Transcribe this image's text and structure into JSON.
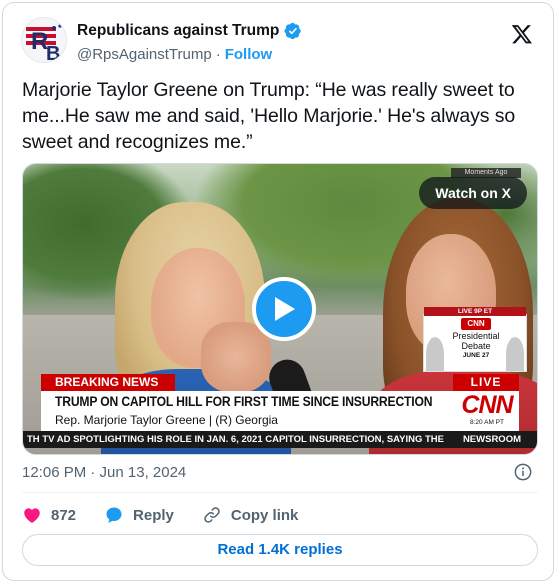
{
  "author": {
    "name": "Republicans against Trump",
    "handle": "@RpsAgainstTrump",
    "separator": "·",
    "follow_label": "Follow",
    "avatar_letters": "RB"
  },
  "tweet": {
    "text": "Marjorie Taylor Greene on Trump: “He was really sweet to me...He saw me and said, 'Hello Marjorie.' He's always so sweet and recognizes me.”"
  },
  "video": {
    "watch_label": "Watch on X",
    "top_tag": "Moments Ago",
    "promo": {
      "top": "LIVE 9P ET",
      "logo": "CNN",
      "title": "Presidential Debate",
      "date": "JUNE 27"
    },
    "chyron": {
      "breaking": "BREAKING NEWS",
      "live": "LIVE",
      "headline": "TRUMP ON CAPITOL HILL FOR FIRST TIME SINCE INSURRECTION",
      "subline": "Rep. Marjorie Taylor Greene  |  (R) Georgia",
      "network": "CNN",
      "time": "8:20 AM PT",
      "ticker": "TH TV AD SPOTLIGHTING HIS ROLE IN JAN. 6, 2021 CAPITOL INSURRECTION, SAYING THE",
      "ticker_tag": "NEWSROOM"
    }
  },
  "meta": {
    "timestamp": "12:06 PM · Jun 13, 2024"
  },
  "actions": {
    "likes": "872",
    "reply_label": "Reply",
    "copy_label": "Copy link"
  },
  "replies_button": "Read 1.4K replies",
  "colors": {
    "accent": "#1d9bf0",
    "like": "#f91880",
    "link": "#006fd6",
    "cnn_red": "#cc0000"
  },
  "icons": [
    "verified-badge-icon",
    "x-logo-icon",
    "play-icon",
    "info-icon",
    "heart-icon",
    "reply-icon",
    "link-icon"
  ]
}
